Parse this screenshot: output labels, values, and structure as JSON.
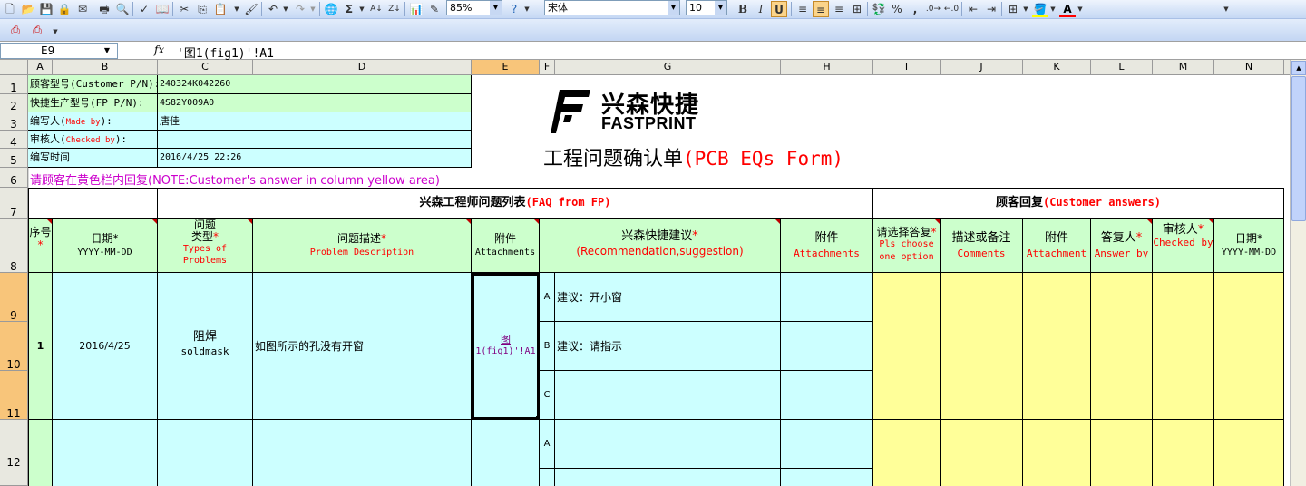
{
  "toolbar": {
    "zoom": "85%",
    "font_name": "宋体",
    "font_size": "10",
    "bold": "B",
    "italic": "I",
    "underline": "U",
    "percent": "%",
    "comma": ",",
    "sigma": "Σ"
  },
  "formula_bar": {
    "name_box": "E9",
    "fx": "fx",
    "formula": "'图1(fig1)'!A1"
  },
  "columns": [
    "A",
    "B",
    "C",
    "D",
    "E",
    "F",
    "G",
    "H",
    "I",
    "J",
    "K",
    "L",
    "M",
    "N"
  ],
  "rows": [
    "1",
    "2",
    "3",
    "4",
    "5",
    "6",
    "7",
    "8",
    "9",
    "10",
    "11",
    "12"
  ],
  "header_info": {
    "customer_pn_label": "顾客型号(Customer P/N):",
    "customer_pn_value": "240324K042260",
    "fp_pn_label": "快捷生产型号(FP P/N):",
    "fp_pn_value": "4S82Y009A0",
    "made_by_label": "编写人(",
    "made_by_en": "Made by",
    "made_by_suffix": "):",
    "made_by_value": "唐佳",
    "checked_by_label": "审核人(",
    "checked_by_en": "Checked by",
    "checked_by_suffix": "):",
    "checked_by_value": "",
    "time_label": "编写时间",
    "time_value": "2016/4/25 22:26"
  },
  "logo": {
    "cn": "兴森快捷",
    "en": "FASTPRINT"
  },
  "form_title": {
    "cn": "工程问题确认单",
    "en": "(PCB EQs Form)"
  },
  "note": "请顾客在黄色栏内回复(NOTE:Customer's answer in column yellow area)",
  "section_headers": {
    "faq_cn": "兴森工程师问题列表",
    "faq_en": "(FAQ from FP)",
    "customer_cn": "顾客回复",
    "customer_en": "(Customer answers)"
  },
  "table_headers": {
    "seq_cn": "序号",
    "date_cn": "日期*",
    "date_en": "YYYY-MM-DD",
    "type_cn": "问题类型",
    "type_en": "Types of Problems",
    "desc_cn": "问题描述",
    "desc_en": "Problem Description",
    "attach_cn": "附件",
    "attach_en": "Attachments",
    "suggest_cn": "兴森快捷建议",
    "suggest_en": "(Recommendation,suggestion)",
    "attach2_cn": "附件",
    "attach2_en": "Attachments",
    "choose_cn": "请选择答复",
    "choose_en": "Pls choose one option",
    "comments_cn": "描述或备注",
    "comments_en": "Comments",
    "attach3_cn": "附件",
    "attach3_en": "Attachment",
    "answer_cn": "答复人",
    "answer_en": "Answer by",
    "checked_cn": "审核人",
    "checked_en": "Checked by",
    "date2_cn": "日期*",
    "date2_en": "YYYY-MM-DD"
  },
  "problems": [
    {
      "seq": "1",
      "date": "2016/4/25",
      "type_cn": "阻焊",
      "type_en": "soldmask",
      "description": "如图所示的孔没有开窗",
      "attachment_link_1": "图",
      "attachment_link_2": "1(fig1)'!A1",
      "options": [
        {
          "letter": "A",
          "text": "建议：开小窗"
        },
        {
          "letter": "B",
          "text": "建议：请指示"
        },
        {
          "letter": "C",
          "text": ""
        }
      ]
    },
    {
      "seq": "",
      "options": [
        {
          "letter": "A",
          "text": ""
        }
      ]
    }
  ]
}
